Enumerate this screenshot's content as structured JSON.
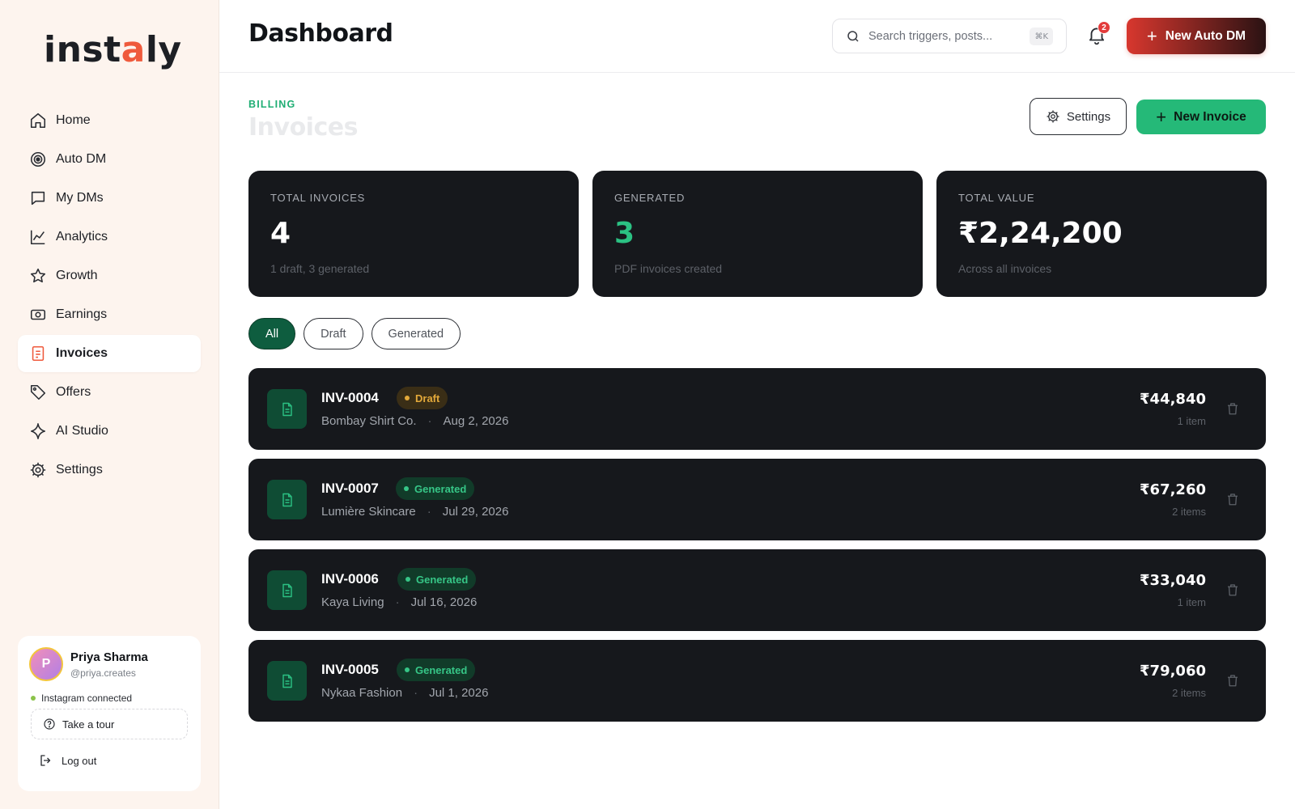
{
  "brand": {
    "logo_pre": "inst",
    "logo_accent": "a",
    "logo_post": "ly",
    "accent_color": "#ef5a3c"
  },
  "sidebar": {
    "items": [
      {
        "label": "Home",
        "icon": "home-icon"
      },
      {
        "label": "Auto DM",
        "icon": "target-icon"
      },
      {
        "label": "My DMs",
        "icon": "chat-bubble-icon"
      },
      {
        "label": "Analytics",
        "icon": "line-chart-icon"
      },
      {
        "label": "Growth",
        "icon": "star-icon"
      },
      {
        "label": "Earnings",
        "icon": "banknote-icon"
      },
      {
        "label": "Invoices",
        "icon": "document-icon",
        "active": true
      },
      {
        "label": "Offers",
        "icon": "tag-icon"
      },
      {
        "label": "AI Studio",
        "icon": "sparkle-icon"
      },
      {
        "label": "Settings",
        "icon": "gear-icon"
      }
    ],
    "profile": {
      "initial": "P",
      "name": "Priya Sharma",
      "handle": "@priya.creates",
      "status": "Instagram connected",
      "tour_label": "Take a tour",
      "logout_label": "Log out"
    }
  },
  "header": {
    "title": "Dashboard",
    "search_placeholder": "Search triggers, posts...",
    "search_shortcut": "⌘K",
    "notification_count": "2",
    "new_auto_dm_label": "New Auto DM"
  },
  "main": {
    "eyebrow": "BILLING",
    "title": "Invoices",
    "settings_label": "Settings",
    "new_invoice_label": "New Invoice",
    "stats": [
      {
        "label": "TOTAL INVOICES",
        "value": "4",
        "sub": "1 draft, 3 generated"
      },
      {
        "label": "GENERATED",
        "value": "3",
        "sub": "PDF invoices created"
      },
      {
        "label": "TOTAL VALUE",
        "value": "₹2,24,200",
        "sub": "Across all invoices"
      }
    ],
    "filters": [
      "All",
      "Draft",
      "Generated"
    ],
    "active_filter": "All",
    "invoices": [
      {
        "number": "INV-0004",
        "status": "Draft",
        "client": "Bombay Shirt Co.",
        "date": "Aug 2, 2026",
        "amount": "₹44,840",
        "items": "1 item"
      },
      {
        "number": "INV-0007",
        "status": "Generated",
        "client": "Lumière Skincare",
        "date": "Jul 29, 2026",
        "amount": "₹67,260",
        "items": "2 items"
      },
      {
        "number": "INV-0006",
        "status": "Generated",
        "client": "Kaya Living",
        "date": "Jul 16, 2026",
        "amount": "₹33,040",
        "items": "1 item"
      },
      {
        "number": "INV-0005",
        "status": "Generated",
        "client": "Nykaa Fashion",
        "date": "Jul 1, 2026",
        "amount": "₹79,060",
        "items": "2 items"
      }
    ]
  }
}
